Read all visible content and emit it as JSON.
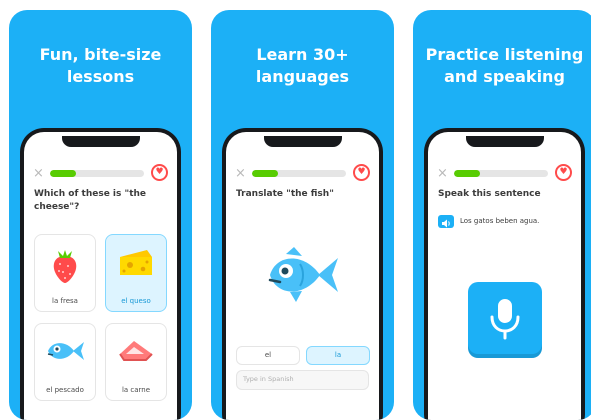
{
  "panels": [
    {
      "title": "Fun, bite-size\nlessons",
      "progress": 0.28,
      "prompt": "Which of these is \"the cheese\"?",
      "choices": [
        {
          "label": "la fresa",
          "icon": "strawberry-icon",
          "selected": false
        },
        {
          "label": "el queso",
          "icon": "cheese-icon",
          "selected": true
        },
        {
          "label": "el pescado",
          "icon": "fish-icon",
          "selected": false
        },
        {
          "label": "la carne",
          "icon": "meat-icon",
          "selected": false
        }
      ]
    },
    {
      "title": "Learn 30+\nlanguages",
      "progress": 0.28,
      "prompt": "Translate \"the fish\"",
      "word_bank": [
        {
          "label": "el",
          "selected": false
        },
        {
          "label": "la",
          "selected": true
        }
      ],
      "input_placeholder": "Type in Spanish"
    },
    {
      "title": "Practice listening\nand speaking",
      "progress": 0.28,
      "prompt": "Speak this sentence",
      "sentence": "Los gatos beben agua.",
      "mic_icon": "microphone-icon"
    }
  ],
  "colors": {
    "brand_blue": "#1cb0f6",
    "progress_green": "#58cc02",
    "heart_red": "#ff4b4b",
    "selected_bg": "#ddf4ff"
  },
  "icons": {
    "close": "×",
    "heart": "♥"
  }
}
